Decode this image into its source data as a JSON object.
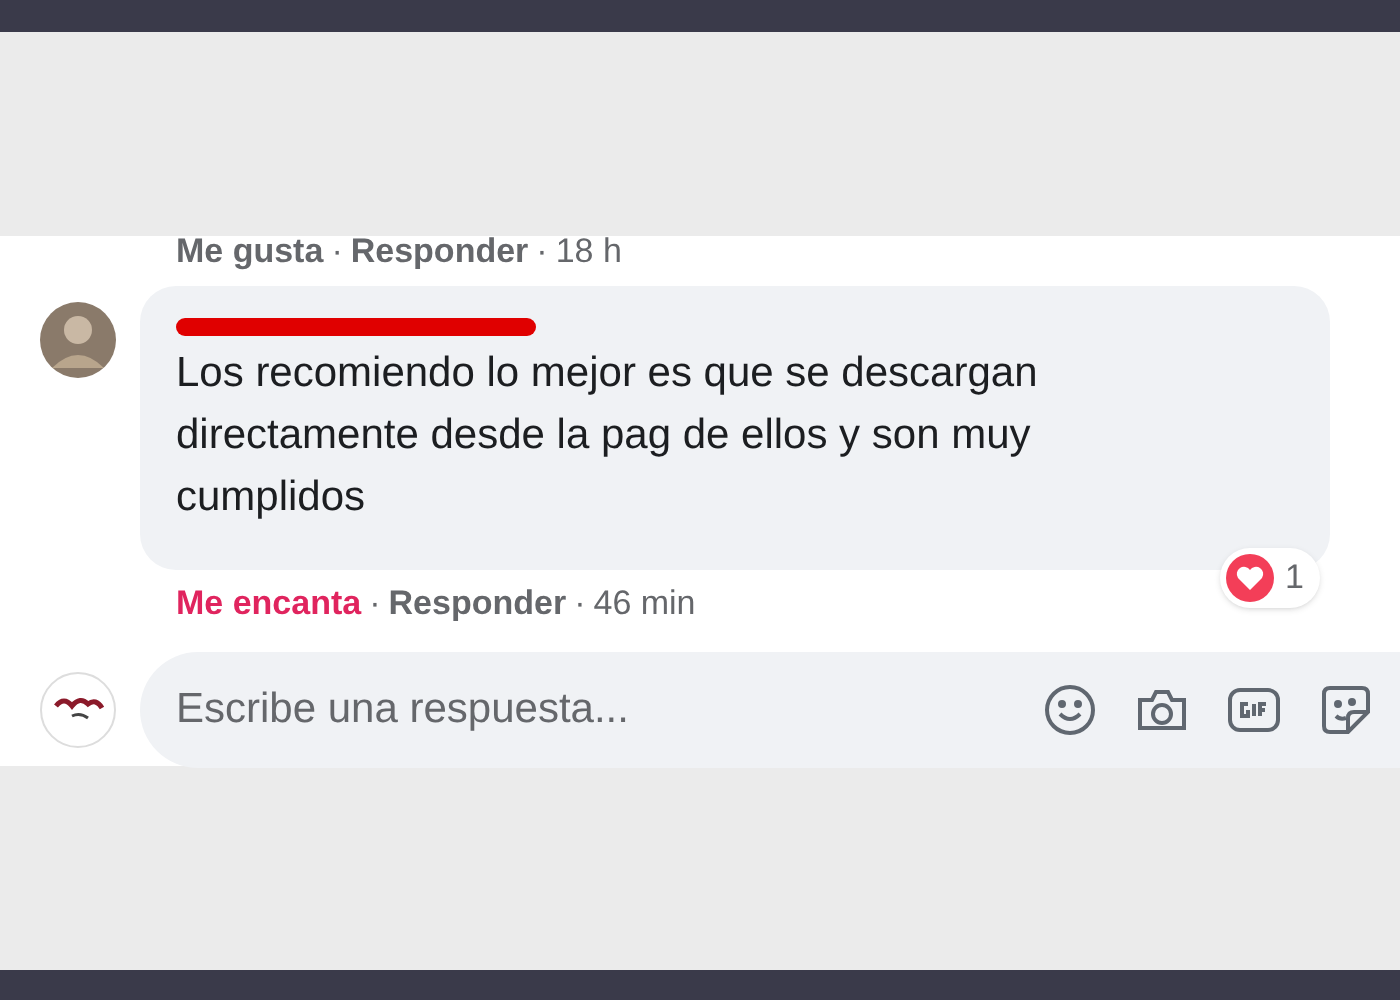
{
  "previous_comment": {
    "actions": [
      {
        "label": "Me gusta",
        "active": false
      },
      {
        "label": "Responder",
        "active": false
      }
    ],
    "separators": [
      "·",
      "·"
    ],
    "time": "18 h"
  },
  "comment": {
    "name_redacted": true,
    "text": "Los recomiendo lo mejor es que se descargan directamente desde la pag de ellos y son muy cumplidos",
    "reaction_count": "1",
    "actions": [
      {
        "label": "Me encanta",
        "active": true
      },
      {
        "label": "Responder",
        "active": false
      }
    ],
    "separators": [
      "·",
      "·"
    ],
    "time": "46 min"
  },
  "reply_box": {
    "placeholder": "Escribe una respuesta..."
  }
}
